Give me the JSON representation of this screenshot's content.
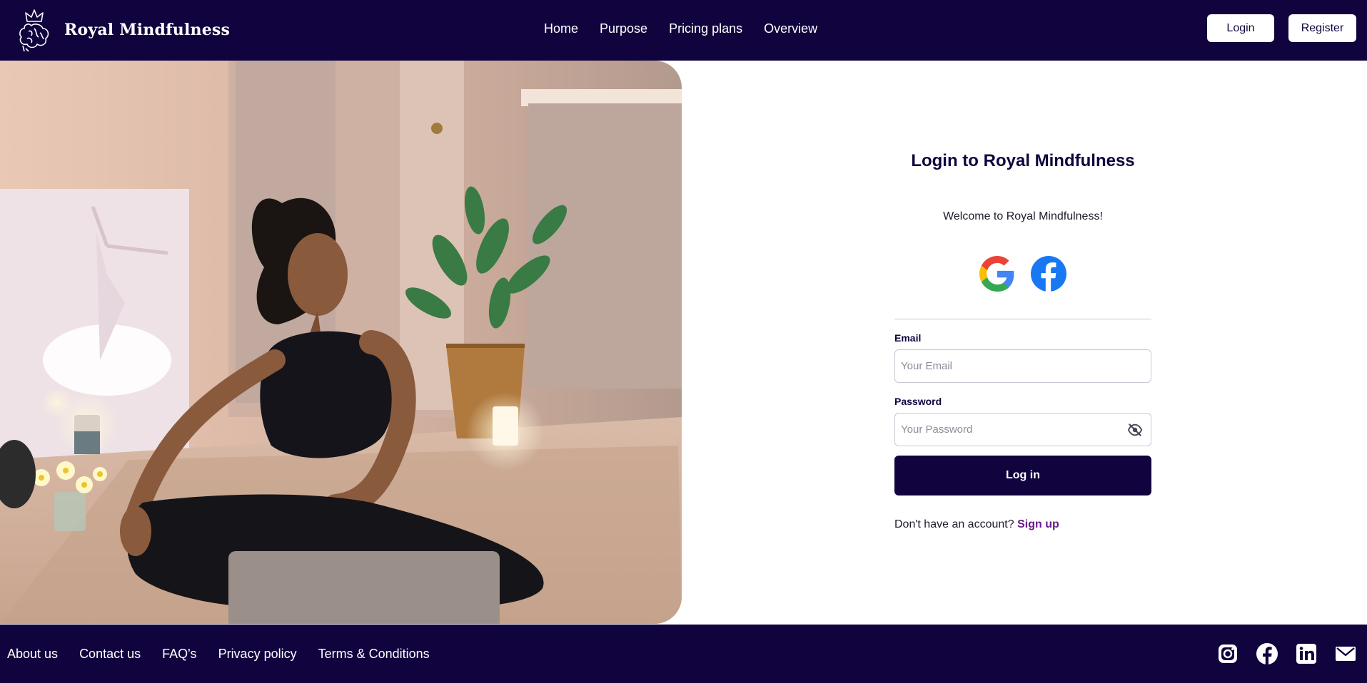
{
  "header": {
    "brand": "Royal Mindfulness",
    "nav": [
      "Home",
      "Purpose",
      "Pricing plans",
      "Overview"
    ],
    "login_label": "Login",
    "register_label": "Register"
  },
  "login": {
    "title": "Login to Royal Mindfulness",
    "welcome": "Welcome to Royal Mindfulness!",
    "social": [
      "google-icon",
      "facebook-icon"
    ],
    "email_label": "Email",
    "email_placeholder": "Your Email",
    "password_label": "Password",
    "password_placeholder": "Your Password",
    "submit_label": "Log in",
    "signup_prompt": "Don't have an account?",
    "signup_link": "Sign up"
  },
  "footer": {
    "links": [
      "About us",
      "Contact us",
      "FAQ's",
      "Privacy policy",
      "Terms & Conditions"
    ],
    "icons": [
      "instagram-icon",
      "facebook-icon",
      "linkedin-icon",
      "mail-icon"
    ]
  },
  "colors": {
    "primary": "#11043e",
    "accent": "#6a1b8a",
    "google_blue": "#4285F4",
    "facebook_blue": "#1877F2"
  }
}
